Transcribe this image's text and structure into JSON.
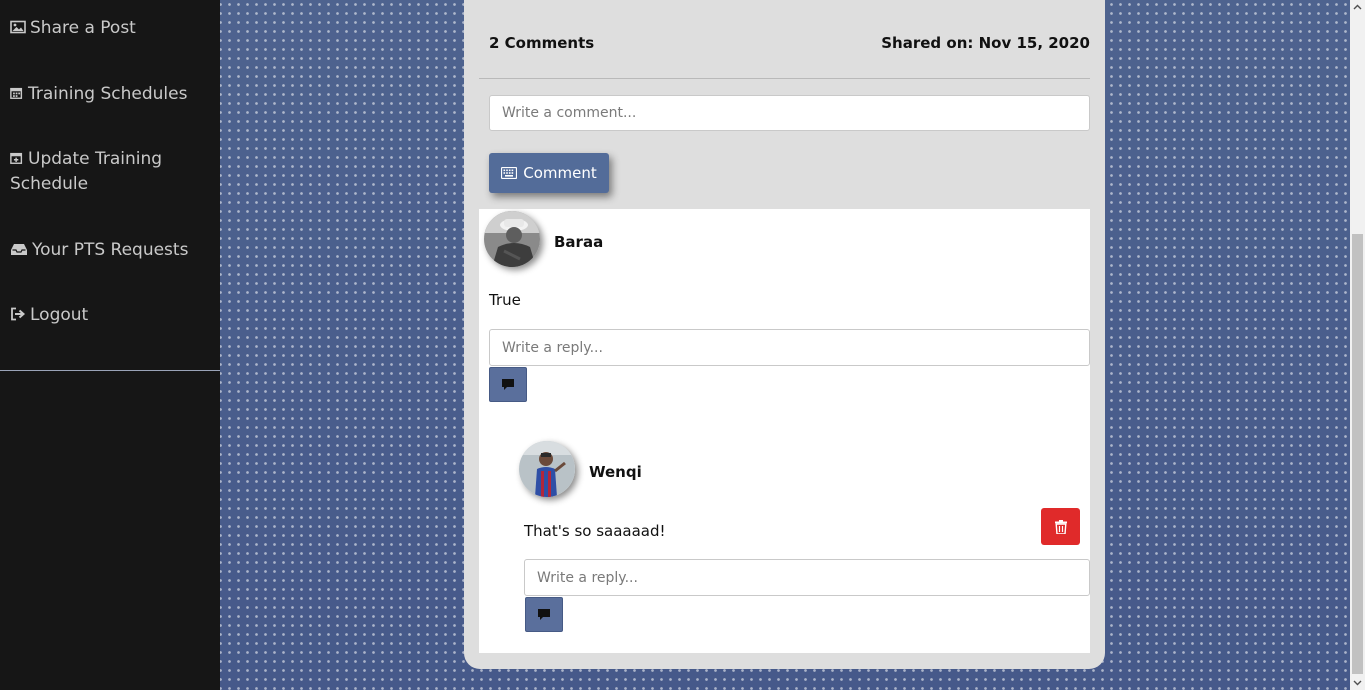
{
  "sidebar": {
    "items": [
      {
        "label": "Share a Post",
        "icon": "image-icon"
      },
      {
        "label": "Training Schedules",
        "icon": "calendar-icon"
      },
      {
        "label": "Update Training Schedule",
        "icon": "calendar-plus-icon"
      },
      {
        "label": "Your PTS Requests",
        "icon": "inbox-icon"
      },
      {
        "label": "Logout",
        "icon": "logout-icon"
      }
    ]
  },
  "post": {
    "comment_count": "2 Comments",
    "shared_on": "Shared on: Nov 15, 2020",
    "comment_placeholder": "Write a comment...",
    "comment_button": "Comment"
  },
  "comments": [
    {
      "author": "Baraa",
      "text": "True",
      "reply_placeholder": "Write a reply...",
      "replies": [
        {
          "author": "Wenqi",
          "text": "That's so saaaaad!",
          "reply_placeholder": "Write a reply..."
        }
      ]
    }
  ],
  "colors": {
    "sidebar_bg": "#161616",
    "accent": "#536c99",
    "delete": "#e02a2a",
    "card_bg": "#dedede"
  }
}
